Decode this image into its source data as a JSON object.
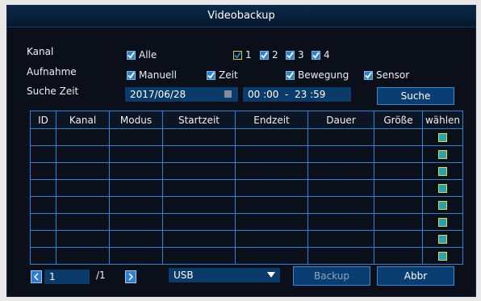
{
  "window": {
    "title": "Videobackup"
  },
  "kanal": {
    "label": "Kanal",
    "all_label": "Alle",
    "channels": [
      "1",
      "2",
      "3",
      "4"
    ]
  },
  "aufnahme": {
    "label": "Aufnahme",
    "options": [
      "Manuell",
      "Zeit",
      "Bewegung",
      "Sensor"
    ]
  },
  "suche_zeit": {
    "label": "Suche Zeit",
    "date": "2017/06/28",
    "time_range": "00 :00  -  23 :59",
    "search_button": "Suche"
  },
  "table": {
    "headers": [
      "ID",
      "Kanal",
      "Modus",
      "Startzeit",
      "Endzeit",
      "Dauer",
      "Größe",
      "wählen"
    ],
    "row_count": 8
  },
  "footer": {
    "page_current": "1",
    "page_total": "/1",
    "device": "USB",
    "backup_button": "Backup",
    "cancel_button": "Abbr"
  },
  "colors": {
    "accent": "#1e88d6",
    "checkbox": "#2d83c7",
    "field": "#0b3b6b"
  },
  "icons": [
    "check-icon",
    "calendar-icon",
    "chevron-left-icon",
    "chevron-right-icon",
    "dropdown-arrow-icon"
  ]
}
